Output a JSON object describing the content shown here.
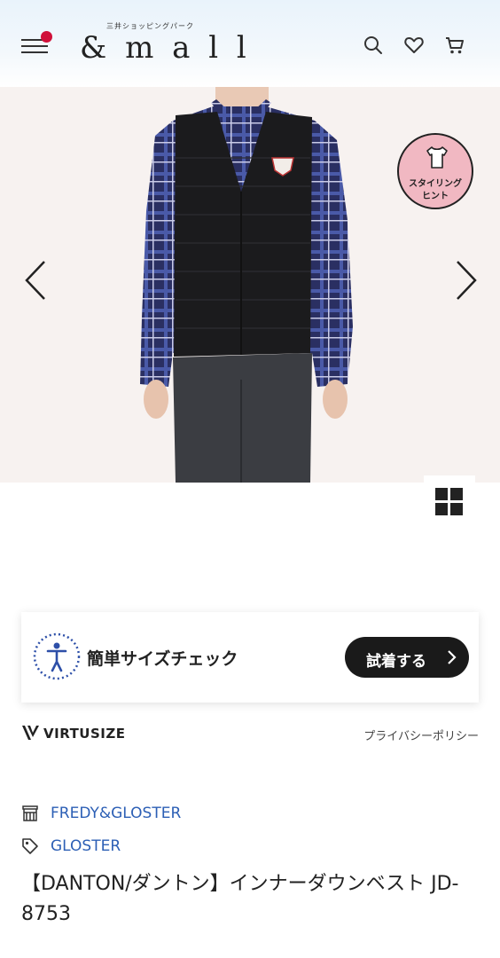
{
  "header": {
    "logo_sub": "三井ショッピングパーク",
    "logo_main": "& m a l l",
    "icons": [
      "menu-icon",
      "search-icon",
      "heart-icon",
      "cart-icon"
    ],
    "notification_dot_color": "#d0103a"
  },
  "gallery": {
    "badge_line1": "スタイリング",
    "badge_line2": "ヒント",
    "badge_color": "#f1b8c2",
    "icons": [
      "chevron-left-icon",
      "chevron-right-icon",
      "tshirt-icon",
      "grid-view-icon"
    ]
  },
  "size_check": {
    "label": "簡単サイズチェック",
    "button_label": "試着する",
    "icons": [
      "body-size-icon",
      "chevron-right-icon"
    ]
  },
  "virtusize": {
    "brand": "VIRTUSIZE",
    "privacy_label": "プライバシーポリシー"
  },
  "product": {
    "shop": "FREDY&GLOSTER",
    "brand": "GLOSTER",
    "title": "【DANTON/ダントン】インナーダウンベスト JD-8753",
    "link_color": "#2c5fb5",
    "icons": [
      "shop-icon",
      "tag-icon"
    ]
  }
}
